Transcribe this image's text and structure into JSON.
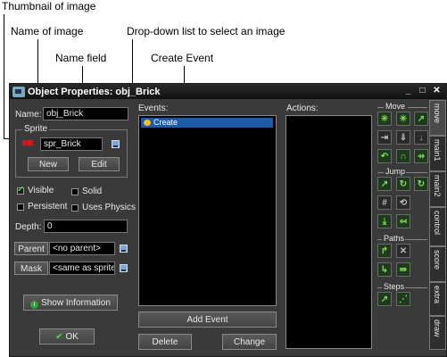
{
  "callouts": {
    "thumbnail": "Thumbnail of image",
    "name_of_image": "Name of image",
    "name_field": "Name field",
    "dropdown": "Drop-down list to select an image",
    "create_event": "Create Event"
  },
  "window": {
    "title": "Object Properties: obj_Brick",
    "minimize": "_",
    "maximize": "□",
    "close": "✕"
  },
  "left": {
    "name_label": "Name:",
    "name_value": "obj_Brick",
    "sprite_group_label": "Sprite",
    "sprite_value": "spr_Brick",
    "new_label": "New",
    "edit_label": "Edit",
    "visible_label": "Visible",
    "visible_checked": true,
    "solid_label": "Solid",
    "solid_checked": false,
    "persistent_label": "Persistent",
    "persistent_checked": false,
    "uses_physics_label": "Uses Physics",
    "uses_physics_checked": false,
    "depth_label": "Depth:",
    "depth_value": "0",
    "parent_label": "Parent",
    "parent_value": "<no parent>",
    "mask_label": "Mask",
    "mask_value": "<same as sprite>",
    "show_info_label": "Show Information",
    "ok_label": "OK"
  },
  "events": {
    "header": "Events:",
    "items": [
      "Create"
    ],
    "add_event_label": "Add Event",
    "delete_label": "Delete",
    "change_label": "Change"
  },
  "actions": {
    "header": "Actions:"
  },
  "library": {
    "sections": [
      "Move",
      "Jump",
      "Paths",
      "Steps"
    ],
    "tabs": [
      "move",
      "main1",
      "main2",
      "control",
      "score",
      "extra",
      "draw"
    ]
  }
}
